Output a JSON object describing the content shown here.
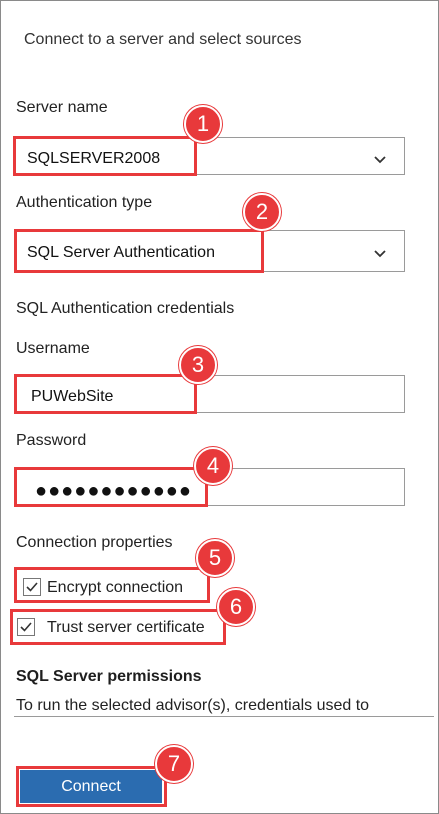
{
  "header": {
    "title": "Connect to a server and select sources"
  },
  "server": {
    "label": "Server name",
    "value": "SQLSERVER2008"
  },
  "auth": {
    "label": "Authentication type",
    "value": "SQL Server Authentication"
  },
  "credentials": {
    "section_label": "SQL Authentication credentials"
  },
  "username": {
    "label": "Username",
    "value": "PUWebSite"
  },
  "password": {
    "label": "Password",
    "value": "●●●●●●●●●●●●"
  },
  "connection": {
    "section_label": "Connection properties",
    "encrypt": {
      "label": "Encrypt connection",
      "checked": true
    },
    "trust": {
      "label": "Trust server certificate",
      "checked": true
    }
  },
  "permissions": {
    "title": "SQL Server permissions",
    "text": "To run the selected advisor(s), credentials used to"
  },
  "actions": {
    "connect_label": "Connect"
  },
  "callouts": [
    "1",
    "2",
    "3",
    "4",
    "5",
    "6",
    "7"
  ],
  "colors": {
    "callout": "#e8393b",
    "button": "#2b6cb0"
  }
}
